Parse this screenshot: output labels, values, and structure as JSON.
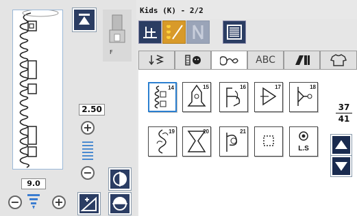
{
  "title": "Kids (K) - 2/2",
  "stitch_width": "2.50",
  "stitch_length": "9.0",
  "foot_label": "F",
  "tabs": [
    "ABC"
  ],
  "stitches": [
    "14",
    "15",
    "16",
    "17",
    "18",
    "19",
    "20",
    "21"
  ],
  "ls_label": "L.S",
  "page": {
    "current": "37",
    "total": "41"
  },
  "colors": {
    "accent": "#2b3d63",
    "selected": "#2a7fd0",
    "tab_active": "#ffffff"
  }
}
